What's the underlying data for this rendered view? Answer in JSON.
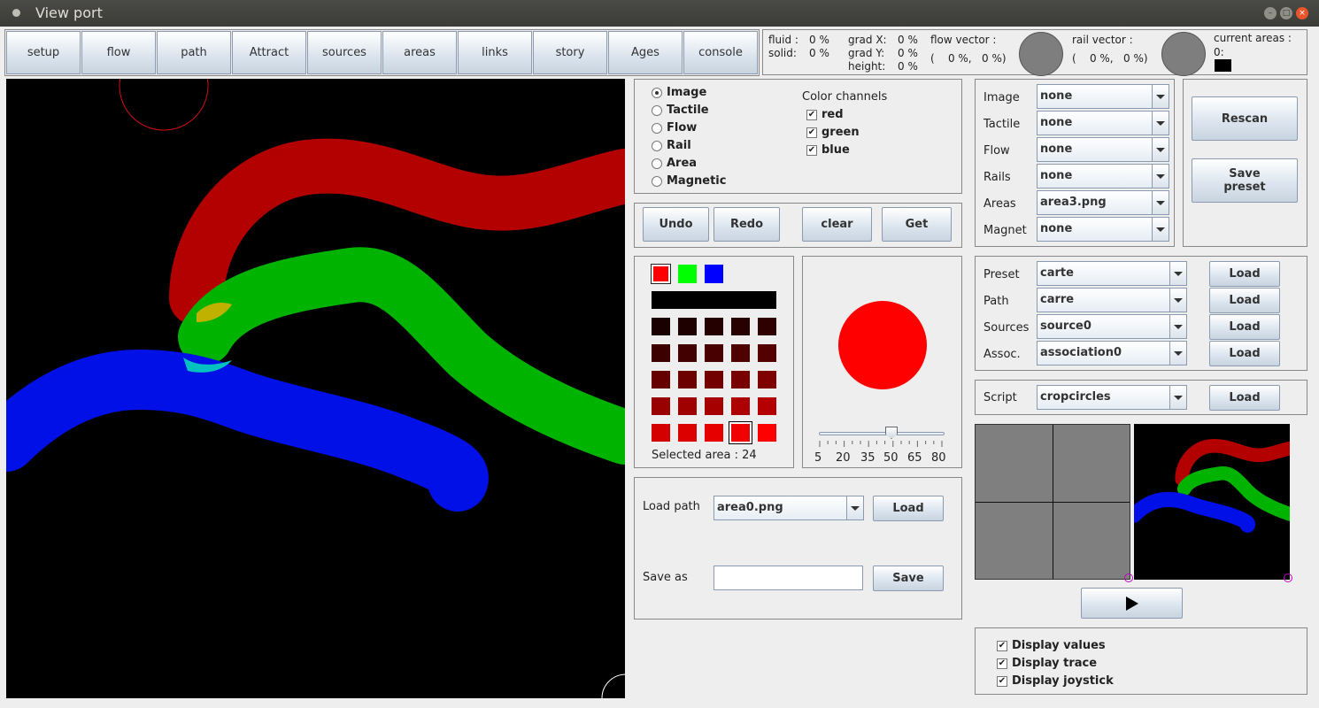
{
  "window": {
    "title": "View port"
  },
  "tabs": [
    "setup",
    "flow",
    "path",
    "Attract",
    "sources",
    "areas",
    "links",
    "story",
    "Ages",
    "console"
  ],
  "stats": {
    "fluid_label": "fluid :",
    "fluid_value": "0 %",
    "solid_label": "solid:",
    "solid_value": "0 %",
    "gradx_label": "grad X:",
    "gradx_value": "0 %",
    "grady_label": "grad Y:",
    "grady_value": "0 %",
    "height_label": "height:",
    "height_value": "0 %",
    "flow_vector_label": "flow vector :",
    "flow_vector_value": "(    0 %,   0 %)",
    "rail_vector_label": "rail vector :",
    "rail_vector_value": "(    0 %,   0 %)",
    "current_areas_label": "current areas :",
    "current_areas_value": "0:"
  },
  "display_mode": {
    "options": [
      "Image",
      "Tactile",
      "Flow",
      "Rail",
      "Area",
      "Magnetic"
    ],
    "selected": "Image"
  },
  "color_channels": {
    "title": "Color channels",
    "channels": [
      {
        "label": "red",
        "checked": true
      },
      {
        "label": "green",
        "checked": true
      },
      {
        "label": "blue",
        "checked": true
      }
    ]
  },
  "edit_buttons": {
    "undo": "Undo",
    "redo": "Redo",
    "clear": "clear",
    "get": "Get"
  },
  "palette": {
    "selected_area_text": "Selected area : 24",
    "base_colors": [
      "#ff0000",
      "#00ff00",
      "#0000ff"
    ],
    "rows": [
      [
        "#1a0000",
        "#1f0000",
        "#240000",
        "#290000",
        "#2e0000"
      ],
      [
        "#3d0000",
        "#430000",
        "#490000",
        "#4f0000",
        "#550000"
      ],
      [
        "#660000",
        "#6c0000",
        "#720000",
        "#780000",
        "#7e0000"
      ],
      [
        "#990000",
        "#9f0000",
        "#a60000",
        "#ad0000",
        "#b40000"
      ],
      [
        "#d40000",
        "#dd0000",
        "#e60000",
        "#f00000",
        "#ff0000"
      ]
    ],
    "selected_index": 23
  },
  "brush": {
    "color": "#ff0000",
    "slider_value": 50,
    "slider_min": 5,
    "slider_max": 80,
    "ticks": [
      "5",
      "20",
      "35",
      "50",
      "65",
      "80"
    ]
  },
  "path_io": {
    "load_path_label": "Load path",
    "load_path_value": "area0.png",
    "load_button": "Load",
    "save_as_label": "Save as",
    "save_as_value": "",
    "save_button": "Save"
  },
  "layers": [
    {
      "label": "Image",
      "value": "none"
    },
    {
      "label": "Tactile",
      "value": "none"
    },
    {
      "label": "Flow",
      "value": "none"
    },
    {
      "label": "Rails",
      "value": "none"
    },
    {
      "label": "Areas",
      "value": "area3.png"
    },
    {
      "label": "Magnet",
      "value": "none"
    }
  ],
  "rescan_button": "Rescan",
  "save_preset_button": "Save preset",
  "presets": [
    {
      "label": "Preset",
      "value": "carte",
      "button": "Load"
    },
    {
      "label": "Path",
      "value": "carre",
      "button": "Load"
    },
    {
      "label": "Sources",
      "value": "source0",
      "button": "Load"
    },
    {
      "label": "Assoc.",
      "value": "association0",
      "button": "Load"
    }
  ],
  "script": {
    "label": "Script",
    "value": "cropcircles",
    "button": "Load"
  },
  "play_icon": "play-icon",
  "display_options": [
    {
      "label": "Display values",
      "checked": true
    },
    {
      "label": "Display trace",
      "checked": true
    },
    {
      "label": "Display joystick",
      "checked": true
    }
  ],
  "colors": {
    "canvas_bg": "#000000",
    "stroke_red": "#b30000",
    "stroke_green": "#00b300",
    "stroke_blue": "#0010e6"
  }
}
